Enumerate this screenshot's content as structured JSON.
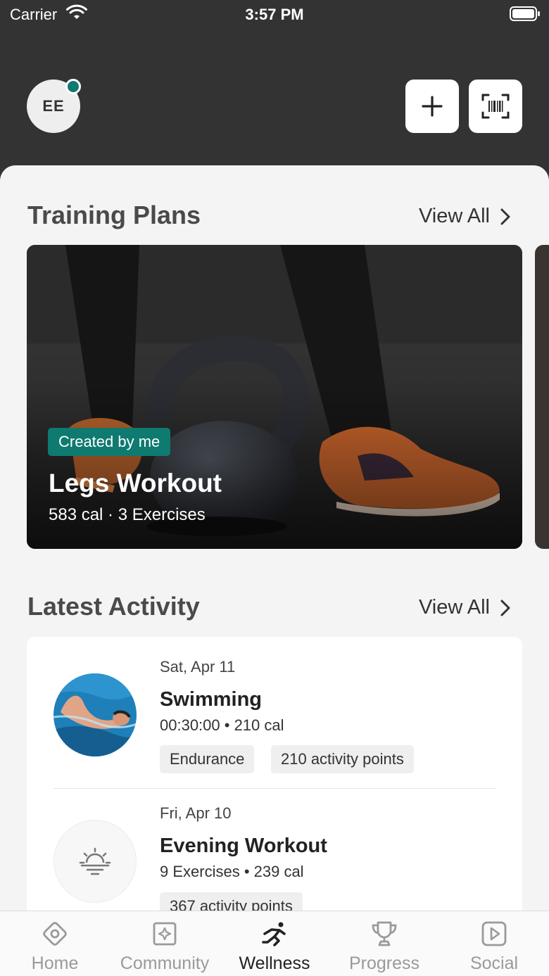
{
  "status_bar": {
    "carrier": "Carrier",
    "time": "3:57 PM"
  },
  "header": {
    "avatar_initials": "EE",
    "icons": [
      "plus-icon",
      "barcode-scan-icon"
    ]
  },
  "training_plans": {
    "title": "Training Plans",
    "view_all": "View All",
    "card": {
      "badge": "Created by me",
      "title": "Legs Workout",
      "meta": "583 cal · 3 Exercises"
    }
  },
  "latest_activity": {
    "title": "Latest Activity",
    "view_all": "View All",
    "items": [
      {
        "date": "Sat, Apr 11",
        "name": "Swimming",
        "meta": "00:30:00 • 210 cal",
        "chips": [
          "Endurance",
          "210 activity points"
        ],
        "icon": "swimmer-photo"
      },
      {
        "date": "Fri, Apr 10",
        "name": "Evening Workout",
        "meta": "9 Exercises • 239 cal",
        "chips": [
          "367 activity points"
        ],
        "icon": "sunset-icon"
      }
    ]
  },
  "tabs": [
    {
      "label": "Home",
      "icon": "home-icon",
      "active": false
    },
    {
      "label": "Community",
      "icon": "community-icon",
      "active": false
    },
    {
      "label": "Wellness",
      "icon": "wellness-icon",
      "active": true
    },
    {
      "label": "Progress",
      "icon": "trophy-icon",
      "active": false
    },
    {
      "label": "Social",
      "icon": "play-icon",
      "active": false
    }
  ],
  "colors": {
    "accent": "#0f7a70",
    "header_bg": "#333333"
  }
}
